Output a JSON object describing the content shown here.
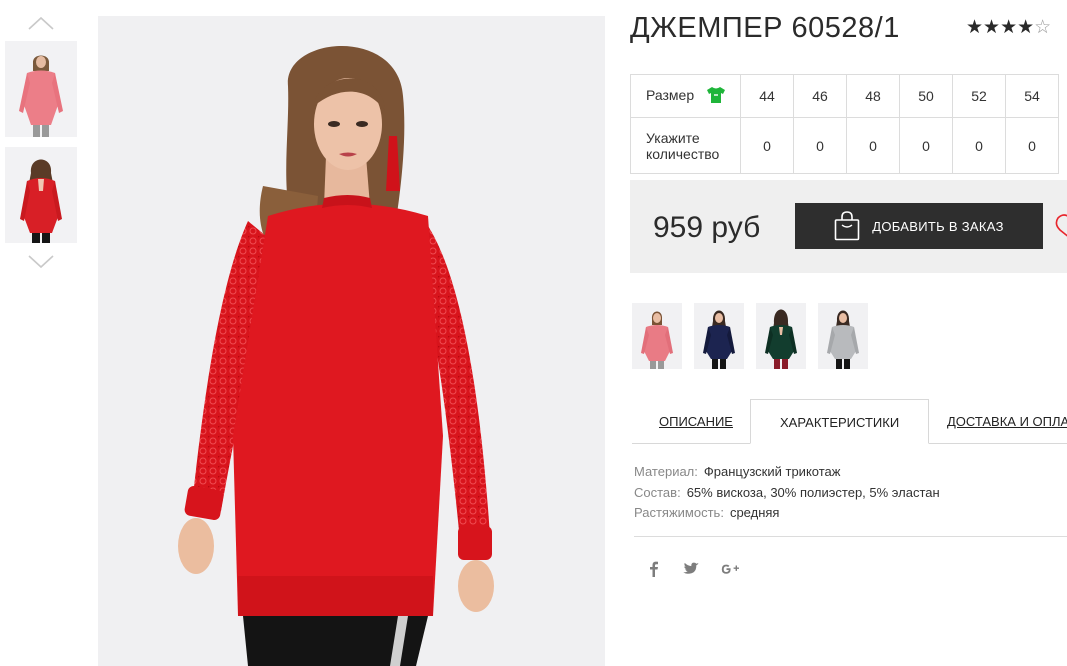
{
  "product": {
    "title": "ДЖЕМПЕР 60528/1",
    "rating": 4,
    "rating_max": 5,
    "rating_stars_filled": "★★★★",
    "rating_stars_empty": "☆"
  },
  "sizes": {
    "size_label": "Размер",
    "size_icon": "tshirt-icon",
    "qty_label": "Укажите количество",
    "values": [
      "44",
      "46",
      "48",
      "50",
      "52",
      "54"
    ],
    "quantities": [
      "0",
      "0",
      "0",
      "0",
      "0",
      "0"
    ]
  },
  "purchase": {
    "price": "959 руб",
    "order_button": "ДОБАВИТЬ В ЗАКАЗ"
  },
  "tabs": [
    {
      "label": "ОПИСАНИЕ",
      "active": false
    },
    {
      "label": "ХАРАКТЕРИСТИКИ",
      "active": true
    },
    {
      "label": "ДОСТАВКА И ОПЛАТА",
      "active": false
    }
  ],
  "specs": [
    {
      "key": "Материал:",
      "value": "Французский трикотаж"
    },
    {
      "key": "Состав:",
      "value": "65% вискоза, 30% полиэстер, 5% эластан"
    },
    {
      "key": "Растяжимость:",
      "value": "средняя"
    }
  ],
  "colors": {
    "accent": "#e8262d",
    "button_bg": "#2e2e2e",
    "size_icon": "#1fb53a",
    "variants": [
      "#e97b85",
      "#1c2450",
      "#123d2e",
      "#b8babd"
    ]
  },
  "social": [
    "facebook-icon",
    "twitter-icon",
    "google-plus-icon"
  ]
}
